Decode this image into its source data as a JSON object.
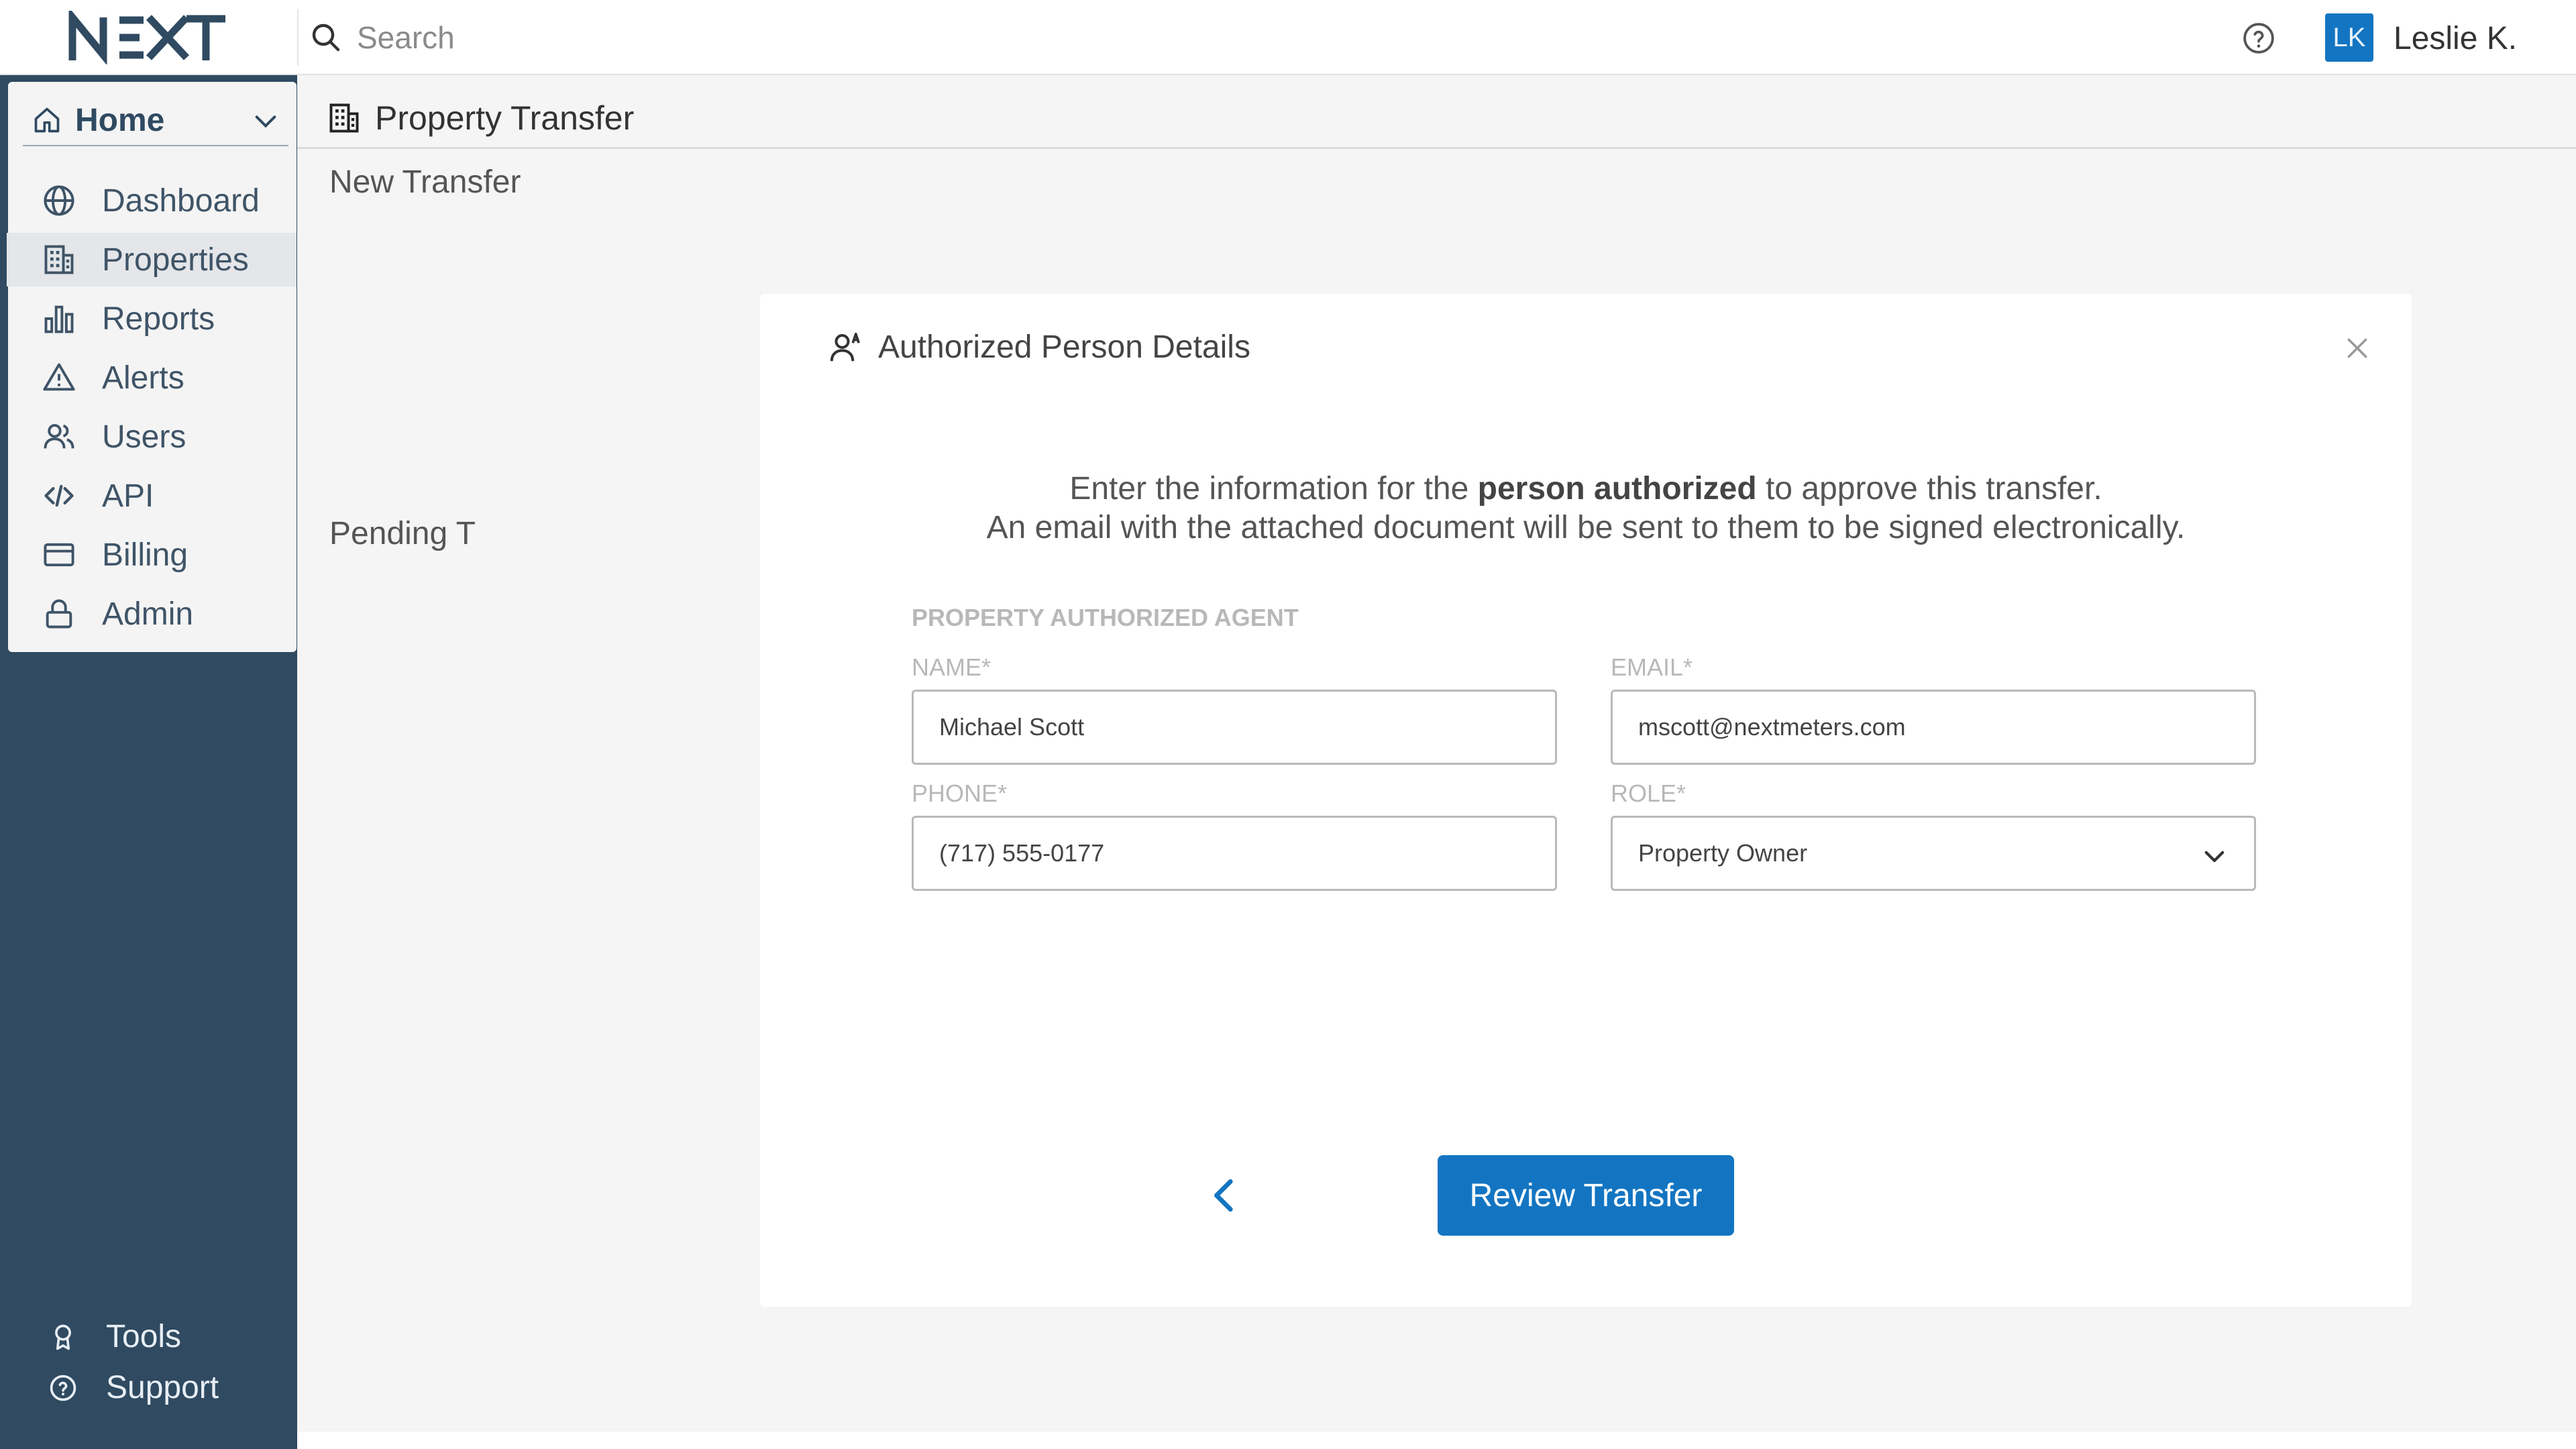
{
  "brand": {
    "logo_text": "NEXT",
    "accent": "#1375c2",
    "sidebar_bg": "#2f4a61"
  },
  "topbar": {
    "search_placeholder": "Search",
    "help_icon": "question-circle-icon",
    "user_initials": "LK",
    "user_name": "Leslie K."
  },
  "sidebar": {
    "home_label": "Home",
    "items": [
      {
        "label": "Dashboard",
        "icon": "globe-icon"
      },
      {
        "label": "Properties",
        "icon": "building-icon",
        "active": true
      },
      {
        "label": "Reports",
        "icon": "bar-chart-icon"
      },
      {
        "label": "Alerts",
        "icon": "warning-icon"
      },
      {
        "label": "Users",
        "icon": "users-icon"
      },
      {
        "label": "API",
        "icon": "code-icon"
      },
      {
        "label": "Billing",
        "icon": "credit-card-icon"
      },
      {
        "label": "Admin",
        "icon": "lock-icon"
      }
    ],
    "footer": [
      {
        "label": "Tools",
        "icon": "award-icon"
      },
      {
        "label": "Support",
        "icon": "help-circle-icon"
      }
    ]
  },
  "page": {
    "title": "Property Transfer",
    "new_transfer": "New Transfer",
    "pending": "Pending T"
  },
  "modal": {
    "title": "Authorized Person Details",
    "intro_line1_before": "Enter the information for the ",
    "intro_line1_bold": "person authorized",
    "intro_line1_after": " to approve this transfer.",
    "intro_line2": "An email with the attached document will be sent to them to be signed electronically.",
    "section_label": "PROPERTY AUTHORIZED AGENT",
    "name_label": "NAME*",
    "name_value": "Michael Scott",
    "email_label": "EMAIL*",
    "email_value": "mscott@nextmeters.com",
    "phone_label": "PHONE*",
    "phone_value": "(717) 555-0177",
    "role_label": "ROLE*",
    "role_value": "Property Owner",
    "review_button": "Review Transfer"
  }
}
